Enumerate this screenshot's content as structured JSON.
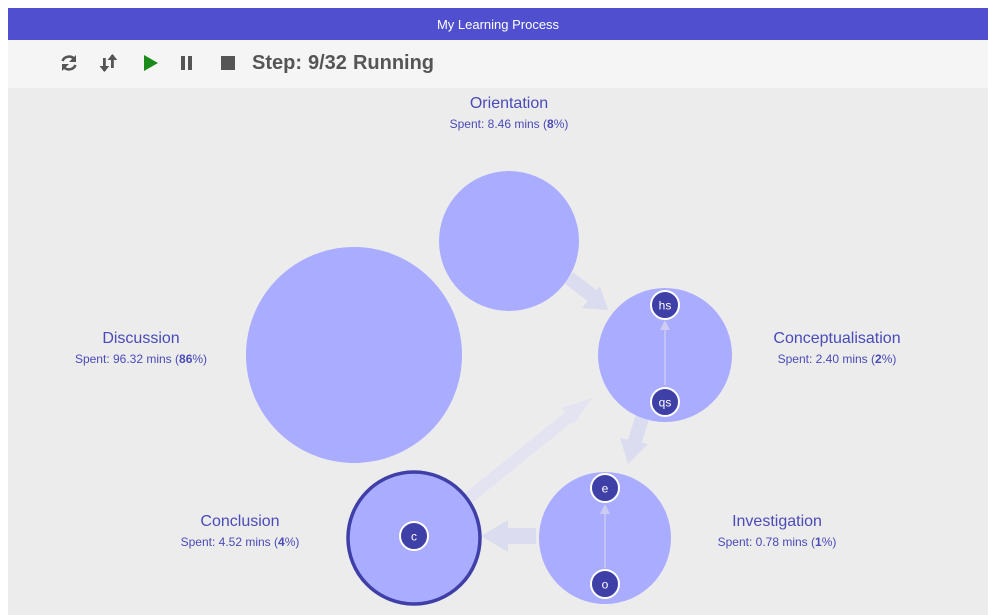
{
  "window": {
    "title": "My Learning Process"
  },
  "toolbar": {
    "icons": [
      "refresh-icon",
      "sort-icon",
      "play-icon",
      "pause-icon",
      "stop-icon"
    ],
    "step_label": "Step:",
    "step_value": "9/32",
    "status": "Running",
    "play_color": "#1a8a1a"
  },
  "colors": {
    "bubble_fill": "#a9acff",
    "node_fill": "#3f3fa8",
    "active_ring": "#3f3fa8",
    "label_text": "#4a4ab8",
    "titlebar": "#4f4fcf"
  },
  "phases": [
    {
      "name": "Orientation",
      "spent_prefix": "Spent: 8.46 mins (",
      "percent": "8",
      "spent_suffix": "%)",
      "nodes": []
    },
    {
      "name": "Conceptualisation",
      "spent_prefix": "Spent: 2.40 mins (",
      "percent": "2",
      "spent_suffix": "%)",
      "nodes": [
        "hs",
        "qs"
      ]
    },
    {
      "name": "Investigation",
      "spent_prefix": "Spent: 0.78 mins (",
      "percent": "1",
      "spent_suffix": "%)",
      "nodes": [
        "e",
        "o"
      ]
    },
    {
      "name": "Conclusion",
      "spent_prefix": "Spent: 4.52 mins (",
      "percent": "4",
      "spent_suffix": "%)",
      "nodes": [
        "c"
      ],
      "active": true
    },
    {
      "name": "Discussion",
      "spent_prefix": "Spent: 96.32 mins (",
      "percent": "86",
      "spent_suffix": "%)",
      "nodes": []
    }
  ]
}
